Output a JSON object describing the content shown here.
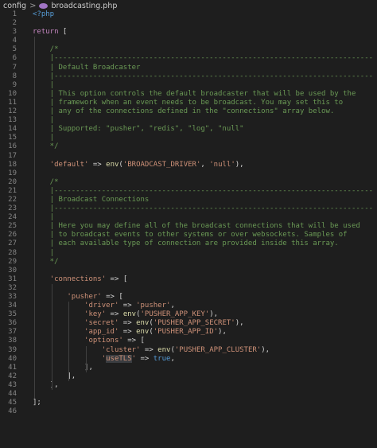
{
  "breadcrumb": {
    "folder": "config",
    "separator": ">",
    "file": "broadcasting.php",
    "file_icon": "php-elephant-icon"
  },
  "lines": [
    {
      "n": "1",
      "tokens": [
        [
          "tag",
          "<?php"
        ]
      ]
    },
    {
      "n": "2",
      "tokens": []
    },
    {
      "n": "3",
      "tokens": [
        [
          "kw",
          "return"
        ],
        [
          "punct",
          " ["
        ]
      ]
    },
    {
      "n": "4",
      "tokens": []
    },
    {
      "n": "5",
      "tokens": [
        [
          "com",
          "    /*"
        ]
      ]
    },
    {
      "n": "6",
      "tokens": [
        [
          "com",
          "    |--------------------------------------------------------------------------"
        ]
      ]
    },
    {
      "n": "7",
      "tokens": [
        [
          "com",
          "    | Default Broadcaster"
        ]
      ]
    },
    {
      "n": "8",
      "tokens": [
        [
          "com",
          "    |--------------------------------------------------------------------------"
        ]
      ]
    },
    {
      "n": "9",
      "tokens": [
        [
          "com",
          "    |"
        ]
      ]
    },
    {
      "n": "10",
      "tokens": [
        [
          "com",
          "    | This option controls the default broadcaster that will be used by the"
        ]
      ]
    },
    {
      "n": "11",
      "tokens": [
        [
          "com",
          "    | framework when an event needs to be broadcast. You may set this to"
        ]
      ]
    },
    {
      "n": "12",
      "tokens": [
        [
          "com",
          "    | any of the connections defined in the \"connections\" array below."
        ]
      ]
    },
    {
      "n": "13",
      "tokens": [
        [
          "com",
          "    |"
        ]
      ]
    },
    {
      "n": "14",
      "tokens": [
        [
          "com",
          "    | Supported: \"pusher\", \"redis\", \"log\", \"null\""
        ]
      ]
    },
    {
      "n": "15",
      "tokens": [
        [
          "com",
          "    |"
        ]
      ]
    },
    {
      "n": "16",
      "tokens": [
        [
          "com",
          "    */"
        ]
      ]
    },
    {
      "n": "17",
      "tokens": []
    },
    {
      "n": "18",
      "tokens": [
        [
          "punct",
          "    "
        ],
        [
          "str",
          "'default'"
        ],
        [
          "punct",
          " => "
        ],
        [
          "fn",
          "env"
        ],
        [
          "punct",
          "("
        ],
        [
          "str",
          "'BROADCAST_DRIVER'"
        ],
        [
          "punct",
          ", "
        ],
        [
          "str",
          "'null'"
        ],
        [
          "punct",
          "),"
        ]
      ]
    },
    {
      "n": "19",
      "tokens": []
    },
    {
      "n": "20",
      "tokens": [
        [
          "com",
          "    /*"
        ]
      ]
    },
    {
      "n": "21",
      "tokens": [
        [
          "com",
          "    |--------------------------------------------------------------------------"
        ]
      ]
    },
    {
      "n": "22",
      "tokens": [
        [
          "com",
          "    | Broadcast Connections"
        ]
      ]
    },
    {
      "n": "23",
      "tokens": [
        [
          "com",
          "    |--------------------------------------------------------------------------"
        ]
      ]
    },
    {
      "n": "24",
      "tokens": [
        [
          "com",
          "    |"
        ]
      ]
    },
    {
      "n": "25",
      "tokens": [
        [
          "com",
          "    | Here you may define all of the broadcast connections that will be used"
        ]
      ]
    },
    {
      "n": "26",
      "tokens": [
        [
          "com",
          "    | to broadcast events to other systems or over websockets. Samples of"
        ]
      ]
    },
    {
      "n": "27",
      "tokens": [
        [
          "com",
          "    | each available type of connection are provided inside this array."
        ]
      ]
    },
    {
      "n": "28",
      "tokens": [
        [
          "com",
          "    |"
        ]
      ]
    },
    {
      "n": "29",
      "tokens": [
        [
          "com",
          "    */"
        ]
      ]
    },
    {
      "n": "30",
      "tokens": []
    },
    {
      "n": "31",
      "tokens": [
        [
          "punct",
          "    "
        ],
        [
          "str",
          "'connections'"
        ],
        [
          "punct",
          " => ["
        ]
      ]
    },
    {
      "n": "32",
      "tokens": []
    },
    {
      "n": "33",
      "tokens": [
        [
          "punct",
          "        "
        ],
        [
          "str",
          "'pusher'"
        ],
        [
          "punct",
          " => ["
        ]
      ]
    },
    {
      "n": "34",
      "tokens": [
        [
          "punct",
          "            "
        ],
        [
          "str",
          "'driver'"
        ],
        [
          "punct",
          " => "
        ],
        [
          "str",
          "'pusher'"
        ],
        [
          "punct",
          ","
        ]
      ]
    },
    {
      "n": "35",
      "tokens": [
        [
          "punct",
          "            "
        ],
        [
          "str",
          "'key'"
        ],
        [
          "punct",
          " => "
        ],
        [
          "fn",
          "env"
        ],
        [
          "punct",
          "("
        ],
        [
          "str",
          "'PUSHER_APP_KEY'"
        ],
        [
          "punct",
          "),"
        ]
      ]
    },
    {
      "n": "36",
      "tokens": [
        [
          "punct",
          "            "
        ],
        [
          "str",
          "'secret'"
        ],
        [
          "punct",
          " => "
        ],
        [
          "fn",
          "env"
        ],
        [
          "punct",
          "("
        ],
        [
          "str",
          "'PUSHER_APP_SECRET'"
        ],
        [
          "punct",
          "),"
        ]
      ]
    },
    {
      "n": "37",
      "tokens": [
        [
          "punct",
          "            "
        ],
        [
          "str",
          "'app_id'"
        ],
        [
          "punct",
          " => "
        ],
        [
          "fn",
          "env"
        ],
        [
          "punct",
          "("
        ],
        [
          "str",
          "'PUSHER_APP_ID'"
        ],
        [
          "punct",
          "),"
        ]
      ]
    },
    {
      "n": "38",
      "tokens": [
        [
          "punct",
          "            "
        ],
        [
          "str",
          "'options'"
        ],
        [
          "punct",
          " => ["
        ]
      ]
    },
    {
      "n": "39",
      "tokens": [
        [
          "punct",
          "                "
        ],
        [
          "str",
          "'cluster'"
        ],
        [
          "punct",
          " => "
        ],
        [
          "fn",
          "env"
        ],
        [
          "punct",
          "("
        ],
        [
          "str",
          "'PUSHER_APP_CLUSTER'"
        ],
        [
          "punct",
          "),"
        ]
      ]
    },
    {
      "n": "40",
      "tokens": [
        [
          "punct",
          "                "
        ],
        [
          "str",
          "'"
        ],
        [
          "strhl",
          "useTLS"
        ],
        [
          "str",
          "'"
        ],
        [
          "punct",
          " => "
        ],
        [
          "bool",
          "true"
        ],
        [
          "punct",
          ","
        ]
      ]
    },
    {
      "n": "41",
      "tokens": [
        [
          "punct",
          "            ],"
        ]
      ]
    },
    {
      "n": "42",
      "tokens": [
        [
          "punct",
          "        ],"
        ]
      ]
    },
    {
      "n": "43",
      "tokens": [
        [
          "punct",
          "    ],"
        ]
      ]
    },
    {
      "n": "44",
      "tokens": []
    },
    {
      "n": "45",
      "tokens": [
        [
          "punct",
          "];"
        ]
      ]
    },
    {
      "n": "46",
      "tokens": []
    }
  ]
}
